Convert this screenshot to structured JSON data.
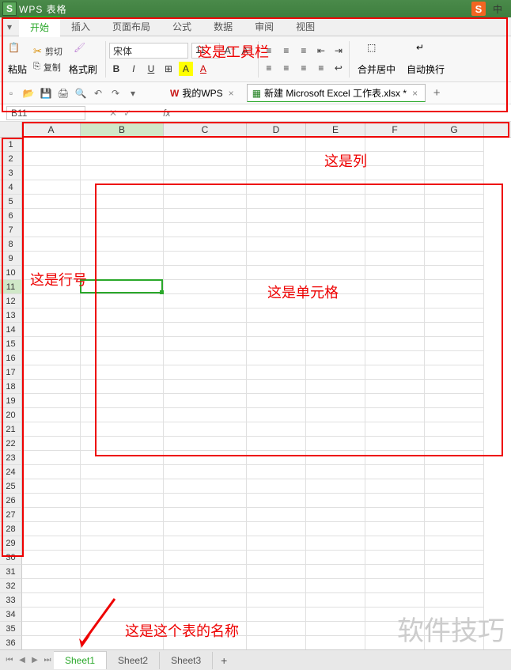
{
  "app": {
    "title": "WPS 表格",
    "logo_letter": "S",
    "corner_s": "S",
    "corner_zh": "中"
  },
  "menu": {
    "dd": "▾",
    "start": "开始",
    "insert": "插入",
    "layout": "页面布局",
    "formula": "公式",
    "data": "数据",
    "review": "审阅",
    "view": "视图"
  },
  "ribbon": {
    "paste": "粘贴",
    "cut": "剪切",
    "copy": "复制",
    "format_painter": "格式刷",
    "font_name": "宋体",
    "font_size": "11",
    "bold": "B",
    "italic": "I",
    "underline": "U",
    "merge_center": "合并居中",
    "wrap": "自动换行"
  },
  "docs": {
    "mywps": "我的WPS",
    "newfile": "新建 Microsoft Excel 工作表.xlsx *"
  },
  "formula": {
    "cellref": "B11",
    "fx": "fx"
  },
  "cols": [
    "A",
    "B",
    "C",
    "D",
    "E",
    "F",
    "G"
  ],
  "active_col": 1,
  "rows": 36,
  "active_row": 11,
  "sheets": {
    "s1": "Sheet1",
    "s2": "Sheet2",
    "s3": "Sheet3",
    "add": "+"
  },
  "nav": {
    "first": "⏮",
    "prev": "◀",
    "next": "▶",
    "last": "⏭"
  },
  "anno": {
    "toolbar": "这是工具栏",
    "cols": "这是列",
    "rows": "这是行号",
    "cell": "这是单元格",
    "sheet": "这是这个表的名称"
  },
  "watermark": "软件技巧"
}
